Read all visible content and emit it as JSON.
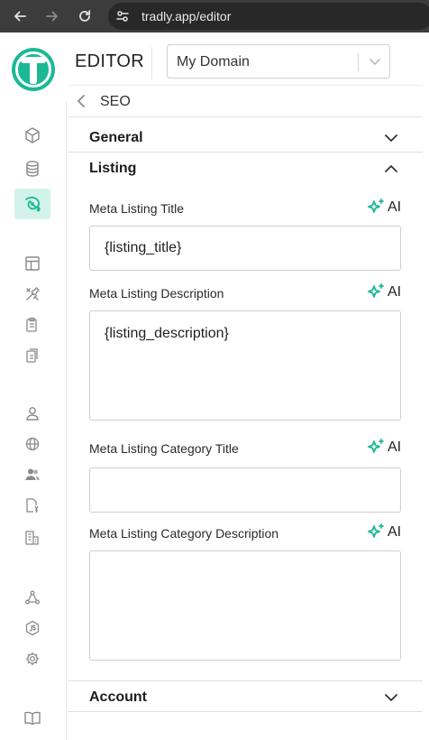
{
  "browser": {
    "url": "tradly.app/editor"
  },
  "header": {
    "title": "EDITOR",
    "domain_select": {
      "value": "My Domain"
    }
  },
  "colors": {
    "accent": "#1bb896",
    "active_bg": "#d3f3ea",
    "chrome": "#3c3c3c"
  },
  "sidebar": {
    "items": [
      {
        "icon": "cube-icon"
      },
      {
        "icon": "database-icon"
      },
      {
        "icon": "paint-icon",
        "active": true
      },
      {
        "icon": "layout-icon"
      },
      {
        "icon": "tools-icon"
      },
      {
        "icon": "clipboard-icon"
      },
      {
        "icon": "clipboard-copy-icon"
      },
      {
        "icon": "user-icon"
      },
      {
        "icon": "globe-icon"
      },
      {
        "icon": "users-icon"
      },
      {
        "icon": "document-currency-icon"
      },
      {
        "icon": "building-icon"
      },
      {
        "icon": "network-icon"
      },
      {
        "icon": "js-icon"
      },
      {
        "icon": "gear-icon"
      },
      {
        "icon": "book-icon"
      }
    ]
  },
  "breadcrumb": {
    "label": "SEO"
  },
  "sections": {
    "general": {
      "title": "General"
    },
    "listing": {
      "title": "Listing",
      "fields": [
        {
          "label": "Meta Listing Title",
          "value": "{listing_title}",
          "ai_label": "AI"
        },
        {
          "label": "Meta Listing Description",
          "value": "{listing_description}",
          "ai_label": "AI"
        },
        {
          "label": "Meta Listing Category Title",
          "value": "",
          "ai_label": "AI"
        },
        {
          "label": "Meta Listing Category Description",
          "value": "",
          "ai_label": "AI"
        }
      ]
    },
    "account": {
      "title": "Account"
    }
  }
}
